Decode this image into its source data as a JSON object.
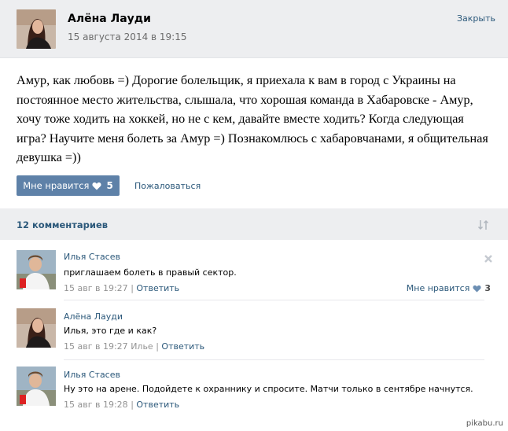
{
  "post": {
    "author": "Алёна Лауди",
    "date": "15 августа 2014 в 19:15",
    "close_label": "Закрыть",
    "text": "Амур, как любовь =) Дорогие болельщик, я приехала к вам в город с Украины на постоянное место жительства, слышала, что хорошая команда в Хабаровске - Амур, хочу тоже ходить на хоккей, но не с кем, давайте вместе ходить? Когда следующая игра? Научите меня болеть за Амур =) Познакомлюсь с хабаровчанами, я общительная девушка =))",
    "like_label": "Мне нравится",
    "like_count": "5",
    "report_label": "Пожаловаться"
  },
  "comments_header": {
    "count_label": "12 комментариев"
  },
  "comments": [
    {
      "author": "Илья Стасев",
      "text": "приглашаем болеть в правый сектор.",
      "time": "15 авг в 19:27",
      "reply_to": "",
      "reply_label": "Ответить",
      "like_label": "Мне нравится",
      "like_count": "3"
    },
    {
      "author": "Алёна Лауди",
      "text": "Илья, это где и как?",
      "time": "15 авг в 19:27",
      "reply_to": "Илье",
      "reply_label": "Ответить"
    },
    {
      "author": "Илья Стасев",
      "text": "Ну это на арене. Подойдете к охраннику и спросите. Матчи только в сентябре начнутся.",
      "time": "15 авг в 19:28",
      "reply_to": "",
      "reply_label": "Ответить"
    }
  ],
  "watermark": "pikabu.ru",
  "colors": {
    "link": "#2b587a",
    "like_button": "#5e81a8",
    "header_bg": "#edeef0"
  }
}
